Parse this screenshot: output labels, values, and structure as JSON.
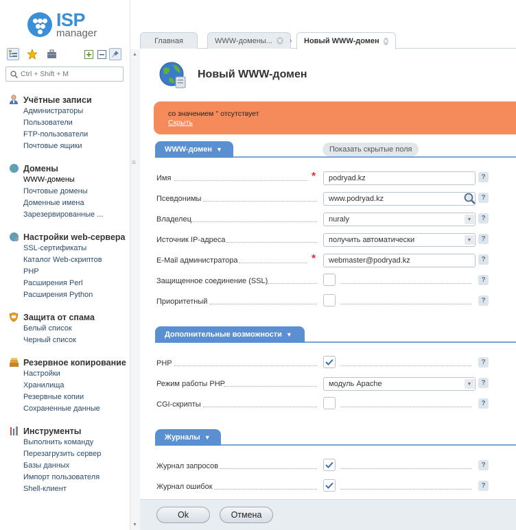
{
  "logo": {
    "brand": "ISP",
    "product": "manager"
  },
  "search": {
    "placeholder": "Ctrl + Shift + M"
  },
  "toolbar": {
    "icons": [
      "tree-view-icon",
      "star-icon",
      "briefcase-icon",
      "expand-all-icon",
      "collapse-all-icon",
      "pin-icon"
    ]
  },
  "sidebar": {
    "groups": [
      {
        "title": "Учётные записи",
        "icon": "users-icon",
        "items": [
          "Администраторы",
          "Пользователи",
          "FTP-пользователи",
          "Почтовые ящики"
        ]
      },
      {
        "title": "Домены",
        "icon": "globe-icon",
        "items": [
          "WWW-домены",
          "Почтовые домены",
          "Доменные имена",
          "Зарезервированные ..."
        ]
      },
      {
        "title": "Настройки web-сервера",
        "icon": "web-server-icon",
        "items": [
          "SSL-сертификаты",
          "Каталог Web-скриптов",
          "PHP",
          "Расширения Perl",
          "Расширения Python"
        ]
      },
      {
        "title": "Защита от спама",
        "icon": "spam-shield-icon",
        "items": [
          "Белый список",
          "Черный список"
        ]
      },
      {
        "title": "Резервное копирование",
        "icon": "backup-icon",
        "items": [
          "Настройки",
          "Хранилища",
          "Резервные копии",
          "Сохраненные данные"
        ]
      },
      {
        "title": "Инструменты",
        "icon": "tools-icon",
        "items": [
          "Выполнить команду",
          "Перезагрузить сервер",
          "Базы данных",
          "Импорт пользователя",
          "Shell-клиент"
        ]
      }
    ]
  },
  "tabs": [
    {
      "label": "Главная"
    },
    {
      "label": "WWW-домены..."
    },
    {
      "label": "Новый WWW-домен"
    }
  ],
  "page": {
    "title": "Новый WWW-домен"
  },
  "alert": {
    "message": "со значением '' отсутствует",
    "link": "Скрыть"
  },
  "sections": {
    "main": {
      "title": "WWW-домен",
      "show_hidden": "Показать скрытые поля"
    },
    "extra": {
      "title": "Дополнительные возможности"
    },
    "logs": {
      "title": "Журналы"
    }
  },
  "fields": {
    "name": {
      "label": "Имя",
      "value": "podryad.kz"
    },
    "aliases": {
      "label": "Псевдонимы",
      "value": "www.podryad.kz"
    },
    "owner": {
      "label": "Владелец",
      "value": "nuraly"
    },
    "ip_source": {
      "label": "Источник IP-адреса",
      "value": "получить автоматически"
    },
    "admin_email": {
      "label": "E-Mail администратора",
      "value": "webmaster@podryad.kz"
    },
    "ssl": {
      "label": "Защищенное соединение (SSL)",
      "checked": false
    },
    "priority": {
      "label": "Приоритетный",
      "checked": false
    },
    "php": {
      "label": "PHP",
      "checked": true
    },
    "php_mode": {
      "label": "Режим работы PHP",
      "value": "модуль Apache"
    },
    "cgi": {
      "label": "CGI-скрипты",
      "checked": false
    },
    "access_log": {
      "label": "Журнал запросов",
      "checked": true
    },
    "error_log": {
      "label": "Журнал ошибок",
      "checked": true
    }
  },
  "help_label": "?",
  "footer": {
    "ok": "Ok",
    "cancel": "Отмена"
  },
  "colors": {
    "accent": "#5a8fd1",
    "alert": "#f58a5a",
    "brand": "#3a8fd6"
  }
}
